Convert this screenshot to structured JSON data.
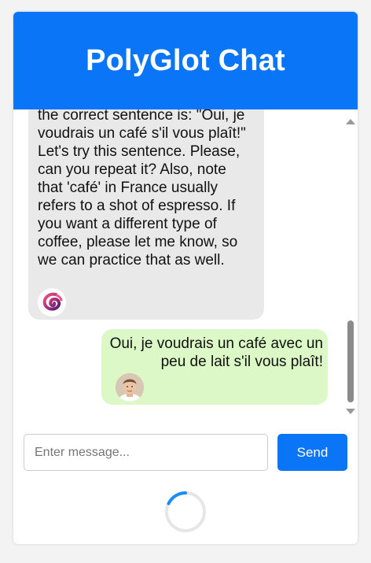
{
  "header": {
    "title": "PolyGlot Chat"
  },
  "messages": [
    {
      "sender": "bot",
      "text": "the correct sentence is: \"Oui, je voudrais un café s'il vous plaît!\" Let's try this sentence. Please, can you repeat it? Also, note that 'café' in France usually refers to a shot of espresso. If you want a different type of coffee, please let me know, so we can practice that as well.",
      "avatar": "swirl-logo-icon"
    },
    {
      "sender": "user",
      "text": "Oui, je voudrais un café avec un peu de lait s'il vous plaît!",
      "avatar": "user-photo"
    }
  ],
  "input": {
    "placeholder": "Enter message...",
    "value": ""
  },
  "send_button": {
    "label": "Send"
  },
  "colors": {
    "accent": "#0a76f7",
    "bot_bubble": "#e9e9e9",
    "user_bubble": "#dcf8c6",
    "spinner": "#1a8cf5"
  },
  "status": {
    "loading": true
  }
}
